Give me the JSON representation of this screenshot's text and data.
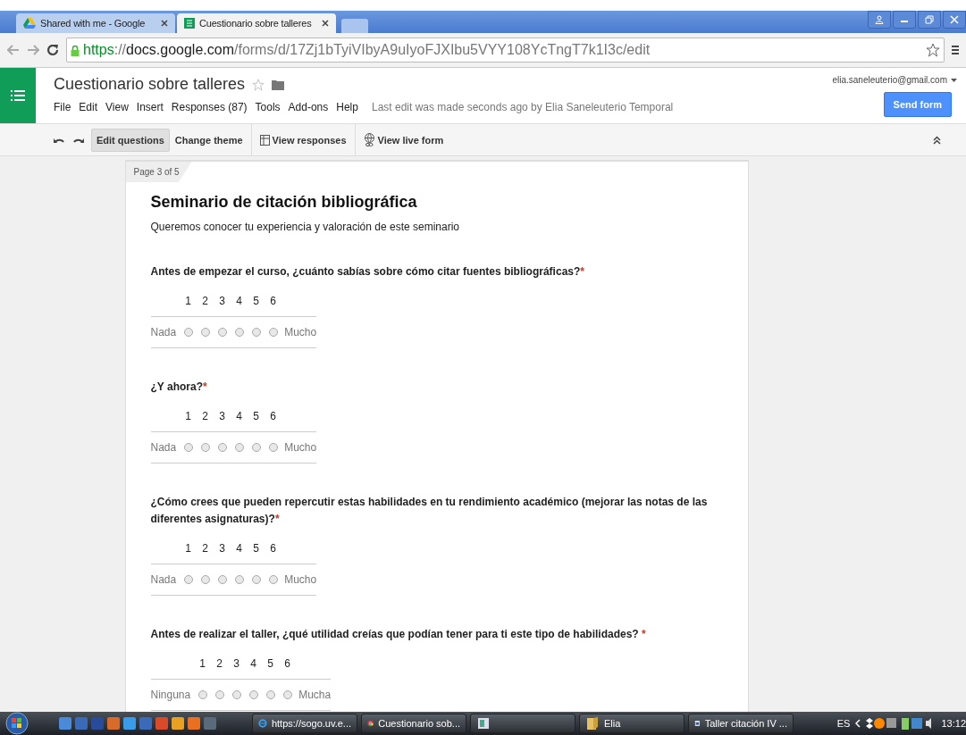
{
  "browser": {
    "tabs": [
      {
        "title": "Shared with me - Google",
        "selected": false
      },
      {
        "title": "Cuestionario sobre talleres",
        "selected": true
      }
    ],
    "url": {
      "scheme": "https",
      "separator": "://",
      "domain": "docs.google.com",
      "path": "/forms/d/17Zj1bTyiVIbyA9uIyoFJXIbu5VYY108YcTngT7k1I3c/edit"
    }
  },
  "app": {
    "title": "Cuestionario sobre talleres",
    "account": "elia.saneleuterio@gmail.com",
    "send_button": "Send form",
    "menu": [
      "File",
      "Edit",
      "View",
      "Insert",
      "Responses (87)",
      "Tools",
      "Add-ons",
      "Help"
    ],
    "last_edit": "Last edit was made seconds ago by Elia Saneleuterio Temporal",
    "toolbar": [
      {
        "label": "Edit questions",
        "selected": true,
        "kind": "text"
      },
      {
        "label": "Change theme",
        "selected": false,
        "kind": "text"
      },
      {
        "label": "View responses",
        "selected": false,
        "kind": "table"
      },
      {
        "label": "View live form",
        "selected": false,
        "kind": "globe"
      }
    ]
  },
  "form": {
    "page_label": "Page 3 of 5",
    "section_title": "Seminario de citación bibliográfica",
    "section_description": "Queremos conocer tu experiencia y valoración de este seminario",
    "questions": [
      {
        "title": "Antes de empezar el curso, ¿cuánto sabías sobre cómo citar fuentes bibliográficas?",
        "required_mark": "*",
        "low": "Nada",
        "high": "Mucho",
        "scale": [
          {
            "label": "1",
            "selected": false
          },
          {
            "label": "2",
            "selected": false
          },
          {
            "label": "3",
            "selected": false
          },
          {
            "label": "4",
            "selected": false
          },
          {
            "label": "5",
            "selected": false
          },
          {
            "label": "6",
            "selected": false
          }
        ]
      },
      {
        "title": "¿Y ahora?",
        "required_mark": "*",
        "low": "Nada",
        "high": "Mucho",
        "scale": [
          {
            "label": "1",
            "selected": false
          },
          {
            "label": "2",
            "selected": false
          },
          {
            "label": "3",
            "selected": false
          },
          {
            "label": "4",
            "selected": false
          },
          {
            "label": "5",
            "selected": false
          },
          {
            "label": "6",
            "selected": false
          }
        ]
      },
      {
        "title": "¿Cómo crees que pueden repercutir estas habilidades en tu rendimiento académico (mejorar las notas de las diferentes asignaturas)?",
        "required_mark": "*",
        "low": "Nada",
        "high": "Mucho",
        "scale": [
          {
            "label": "1",
            "selected": false
          },
          {
            "label": "2",
            "selected": false
          },
          {
            "label": "3",
            "selected": false
          },
          {
            "label": "4",
            "selected": false
          },
          {
            "label": "5",
            "selected": false
          },
          {
            "label": "6",
            "selected": false
          }
        ]
      },
      {
        "title": "Antes de realizar el taller, ¿qué utilidad creías que podían tener para ti este tipo de habilidades? ",
        "required_mark": "*",
        "low": "Ninguna",
        "high": "Mucha",
        "scale": [
          {
            "label": "1",
            "selected": false
          },
          {
            "label": "2",
            "selected": false
          },
          {
            "label": "3",
            "selected": false
          },
          {
            "label": "4",
            "selected": false
          },
          {
            "label": "5",
            "selected": false
          },
          {
            "label": "6",
            "selected": false
          }
        ]
      }
    ]
  },
  "taskbar": {
    "tasks": [
      {
        "label": "https://sogo.uv.e...",
        "kind": "ie"
      },
      {
        "label": "Cuestionario sob...",
        "kind": "chrome"
      },
      {
        "kind": "blank"
      },
      {
        "label": "Elia",
        "kind": "folder"
      },
      {
        "label": "Taller citación IV ...",
        "kind": "word"
      }
    ],
    "language": "ES",
    "time": "13:12"
  }
}
